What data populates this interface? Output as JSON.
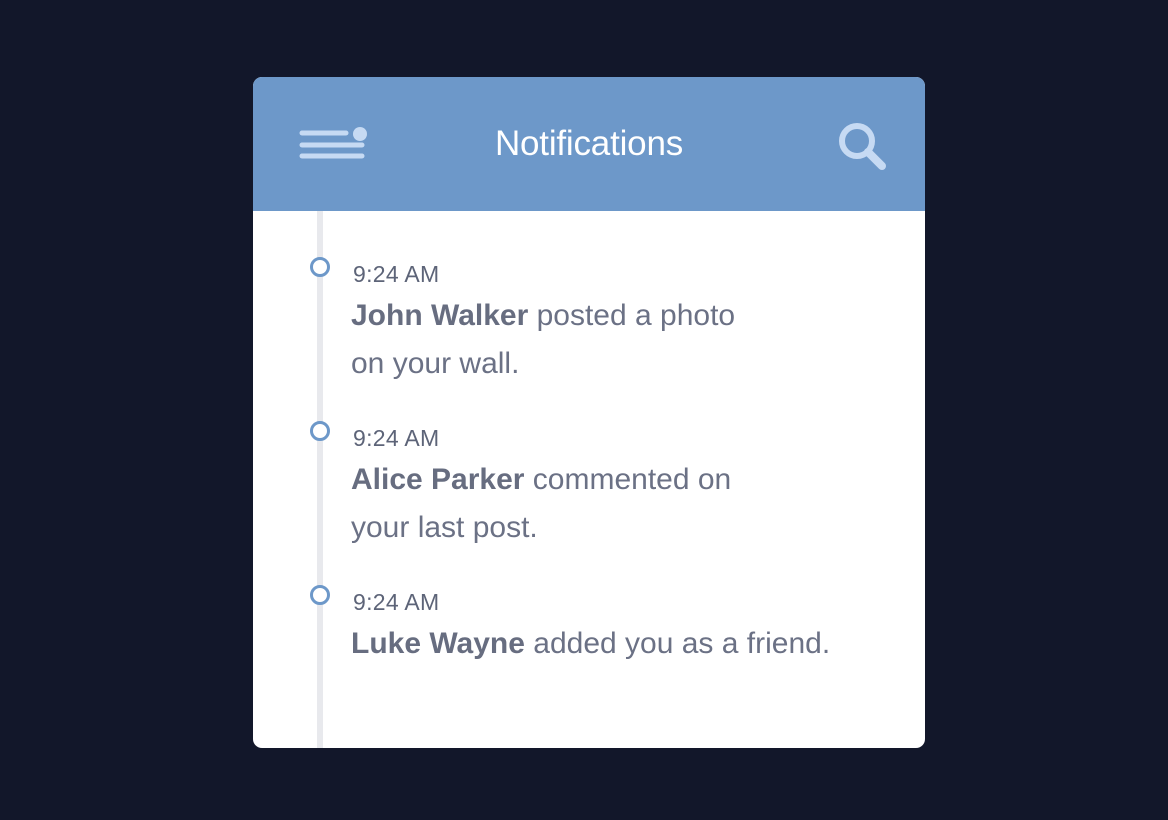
{
  "header": {
    "title": "Notifications",
    "menu_icon": "menu-icon",
    "search_icon": "search-icon"
  },
  "colors": {
    "background": "#12172a",
    "header": "#6d98c9",
    "accent_light": "#c6daf3",
    "text": "#6b7185",
    "timeline": "#e8e9ed"
  },
  "notifications": [
    {
      "time": "9:24 AM",
      "name": "John Walker",
      "line1": " posted a photo",
      "line2": "on your wall."
    },
    {
      "time": "9:24 AM",
      "name": "Alice Parker",
      "line1": " commented on",
      "line2": "your last post."
    },
    {
      "time": "9:24 AM",
      "name": "Luke Wayne",
      "line1": " added you as a friend.",
      "line2": ""
    }
  ]
}
